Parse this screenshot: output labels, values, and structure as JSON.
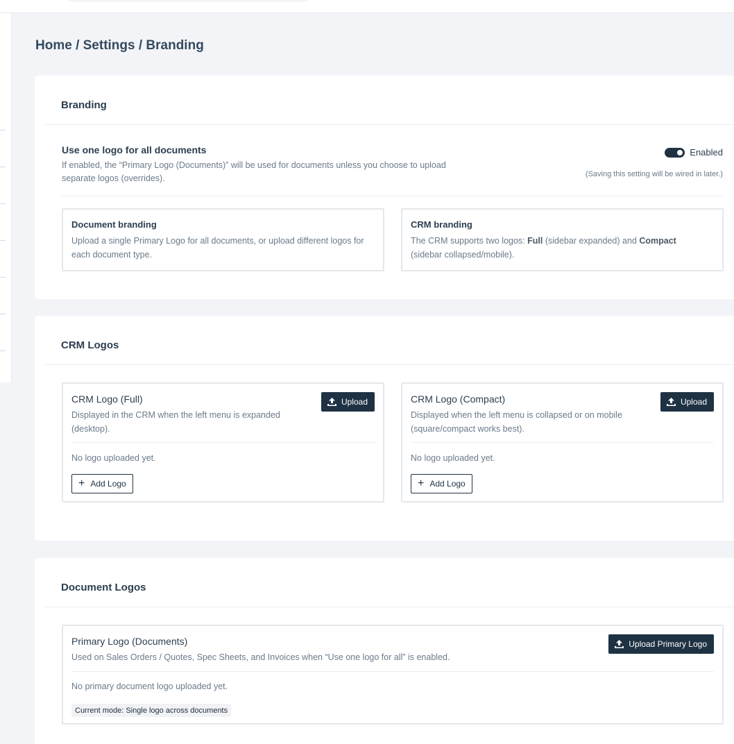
{
  "breadcrumb": "Home / Settings / Branding",
  "branding_card": {
    "title": "Branding",
    "setting": {
      "title": "Use one logo for all documents",
      "description": "If enabled, the “Primary Logo (Documents)” will be used for documents unless you choose to upload separate logos (overrides).",
      "toggle_label": "Enabled",
      "toggle_on": true,
      "note": "(Saving this setting will be wired in later.)"
    },
    "document_branding": {
      "title": "Document branding",
      "description": "Upload a single Primary Logo for all documents, or upload different logos for each document type."
    },
    "crm_branding": {
      "title": "CRM branding",
      "desc_prefix": "The CRM supports two logos: ",
      "desc_full": "Full",
      "desc_middle": " (sidebar expanded) and ",
      "desc_compact": "Compact",
      "desc_suffix": " (sidebar collapsed/mobile)."
    }
  },
  "crm_logos_card": {
    "title": "CRM Logos",
    "full": {
      "title": "CRM Logo (Full)",
      "description": "Displayed in the CRM when the left menu is expanded (desktop).",
      "upload_label": "Upload",
      "empty_text": "No logo uploaded yet.",
      "add_label": "Add Logo"
    },
    "compact": {
      "title": "CRM Logo (Compact)",
      "description": "Displayed when the left menu is collapsed or on mobile (square/compact works best).",
      "upload_label": "Upload",
      "empty_text": "No logo uploaded yet.",
      "add_label": "Add Logo"
    }
  },
  "document_logos_card": {
    "title": "Document Logos",
    "primary": {
      "title": "Primary Logo (Documents)",
      "description": "Used on Sales Orders / Quotes, Spec Sheets, and Invoices when “Use one logo for all” is enabled.",
      "upload_label": "Upload Primary Logo",
      "empty_text": "No primary document logo uploaded yet.",
      "mode_badge": "Current mode: Single logo across documents"
    }
  },
  "colors": {
    "accent_dark": "#1f3244",
    "page_bg": "#f3f4f7",
    "muted_text": "#6b7a8a"
  }
}
